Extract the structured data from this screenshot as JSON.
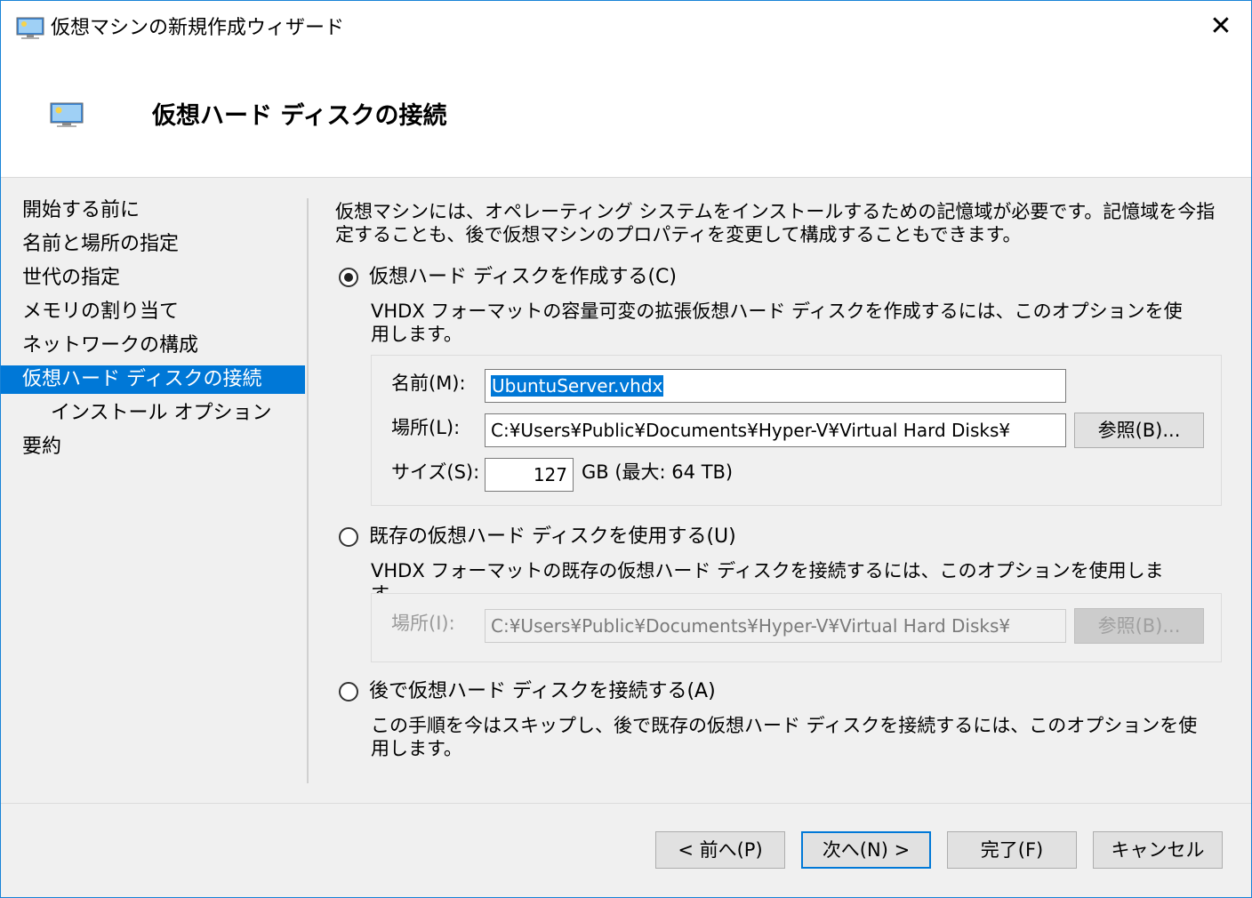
{
  "window": {
    "title": "仮想マシンの新規作成ウィザード",
    "close_glyph": "✕"
  },
  "header": {
    "title": "仮想ハード ディスクの接続"
  },
  "sidebar": {
    "items": [
      {
        "label": "開始する前に"
      },
      {
        "label": "名前と場所の指定"
      },
      {
        "label": "世代の指定"
      },
      {
        "label": "メモリの割り当て"
      },
      {
        "label": "ネットワークの構成"
      },
      {
        "label": "仮想ハード ディスクの接続",
        "active": true
      },
      {
        "label": "インストール オプション",
        "sub": true
      },
      {
        "label": "要約"
      }
    ]
  },
  "main": {
    "intro": "仮想マシンには、オペレーティング システムをインストールするための記憶域が必要です。記憶域を今指定することも、後で仮想マシンのプロパティを変更して構成することもできます。",
    "options": {
      "create": {
        "label": "仮想ハード ディスクを作成する(C)",
        "selected": true,
        "description": "VHDX フォーマットの容量可変の拡張仮想ハード ディスクを作成するには、このオプションを使用します。",
        "name_label": "名前(M):",
        "name_value": "UbuntuServer.vhdx",
        "location_label": "場所(L):",
        "location_value": "C:¥Users¥Public¥Documents¥Hyper-V¥Virtual Hard Disks¥",
        "browse_label": "参照(B)...",
        "size_label": "サイズ(S):",
        "size_value": "127",
        "size_unit": "GB (最大: 64 TB)"
      },
      "existing": {
        "label": "既存の仮想ハード ディスクを使用する(U)",
        "selected": false,
        "description": "VHDX フォーマットの既存の仮想ハード ディスクを接続するには、このオプションを使用します。",
        "location_label": "場所(I):",
        "location_value": "C:¥Users¥Public¥Documents¥Hyper-V¥Virtual Hard Disks¥",
        "browse_label": "参照(B)..."
      },
      "later": {
        "label": "後で仮想ハード ディスクを接続する(A)",
        "selected": false,
        "description": "この手順を今はスキップし、後で既存の仮想ハード ディスクを接続するには、このオプションを使用します。"
      }
    }
  },
  "footer": {
    "prev": "< 前へ(P)",
    "next": "次へ(N) >",
    "finish": "完了(F)",
    "cancel": "キャンセル"
  },
  "icons": {
    "window": "monitor-icon",
    "header": "monitor-icon",
    "close": "close-icon"
  },
  "colors": {
    "accent": "#0078d7",
    "window_border": "#1883d7",
    "background": "#f0f0f0"
  }
}
